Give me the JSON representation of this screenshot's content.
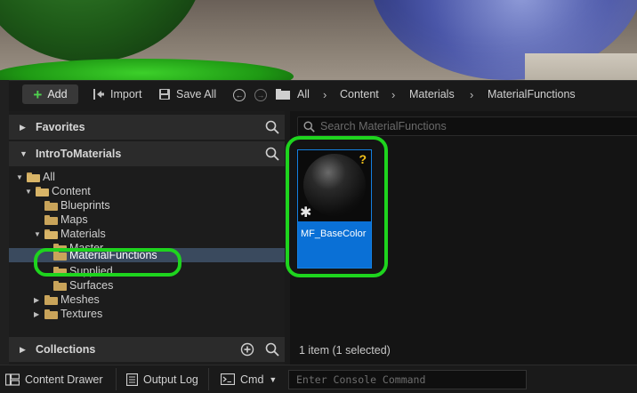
{
  "toolbar": {
    "add_label": "Add",
    "import_label": "Import",
    "save_all_label": "Save All",
    "breadcrumbs": [
      "All",
      "Content",
      "Materials",
      "MaterialFunctions"
    ]
  },
  "left_pane": {
    "favorites_label": "Favorites",
    "project_label": "IntroToMaterials",
    "collections_label": "Collections",
    "tree": [
      {
        "label": "All"
      },
      {
        "label": "Content"
      },
      {
        "label": "Blueprints"
      },
      {
        "label": "Maps"
      },
      {
        "label": "Materials"
      },
      {
        "label": "Master"
      },
      {
        "label": "MaterialFunctions"
      },
      {
        "label": "Supplied"
      },
      {
        "label": "Surfaces"
      },
      {
        "label": "Meshes"
      },
      {
        "label": "Textures"
      }
    ]
  },
  "right_pane": {
    "search_placeholder": "Search MaterialFunctions",
    "asset": {
      "name": "MF_BaseColor",
      "badge": "?"
    },
    "status": "1 item (1 selected)"
  },
  "bottom_bar": {
    "content_drawer_label": "Content Drawer",
    "output_log_label": "Output Log",
    "cmd_label": "Cmd",
    "console_placeholder": "Enter Console Command"
  },
  "colors": {
    "highlight": "#1ed41e",
    "selection": "#0a70d6",
    "folder": "#c9a45a"
  }
}
